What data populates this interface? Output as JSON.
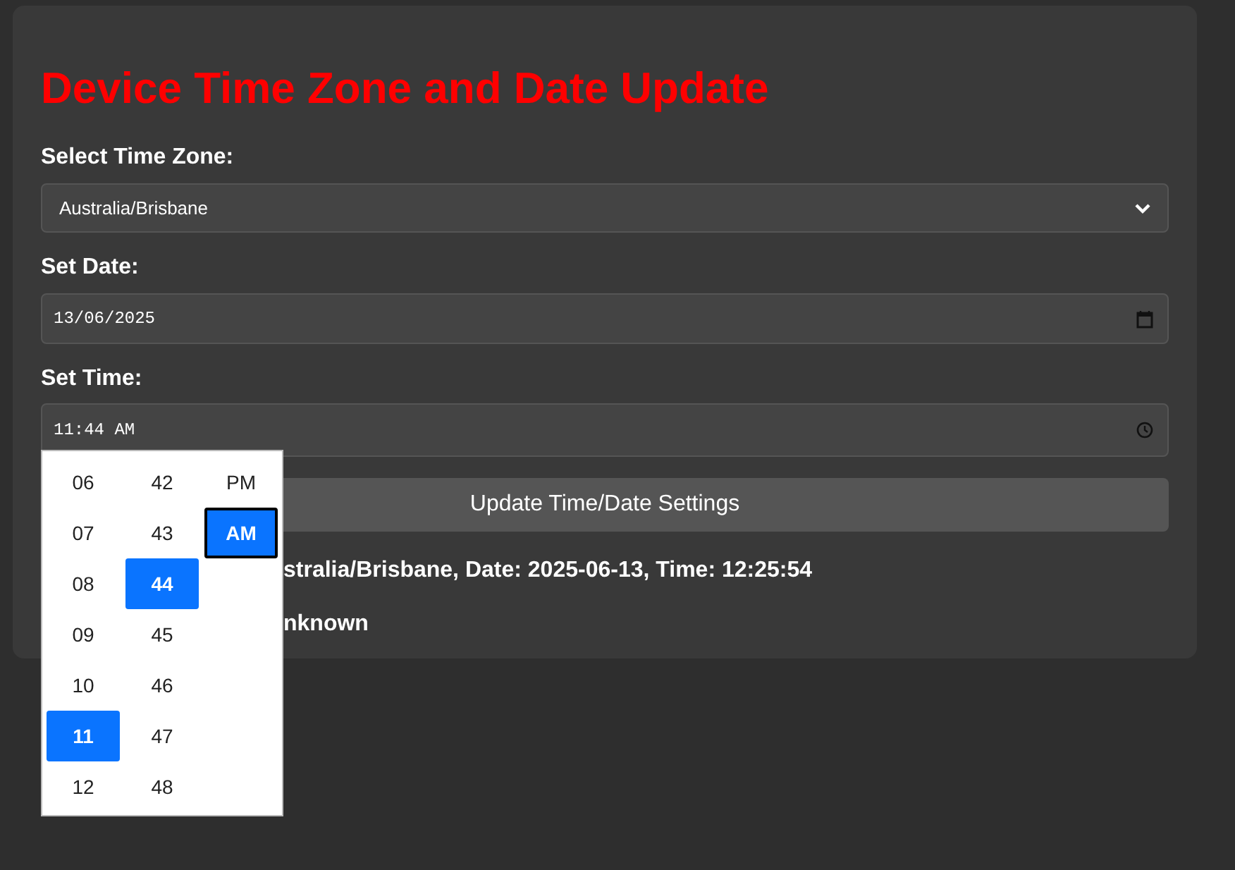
{
  "title": "Device Time Zone and Date Update",
  "timezone": {
    "label": "Select Time Zone:",
    "value": "Australia/Brisbane"
  },
  "date": {
    "label": "Set Date:",
    "value": "13/06/2025"
  },
  "time": {
    "label": "Set Time:",
    "value": "11:44 AM"
  },
  "update_button": "Update Time/Date Settings",
  "status_lines": [
    "stralia/Brisbane, Date: 2025-06-13, Time: 12:25:54",
    "nknown"
  ],
  "time_picker": {
    "columns": [
      [
        {
          "label": "06",
          "selected": false
        },
        {
          "label": "07",
          "selected": false
        },
        {
          "label": "08",
          "selected": false
        },
        {
          "label": "09",
          "selected": false
        },
        {
          "label": "10",
          "selected": false
        },
        {
          "label": "11",
          "selected": true
        },
        {
          "label": "12",
          "selected": false
        }
      ],
      [
        {
          "label": "42",
          "selected": false
        },
        {
          "label": "43",
          "selected": false
        },
        {
          "label": "44",
          "selected": true
        },
        {
          "label": "45",
          "selected": false
        },
        {
          "label": "46",
          "selected": false
        },
        {
          "label": "47",
          "selected": false
        },
        {
          "label": "48",
          "selected": false
        }
      ],
      [
        {
          "label": "PM",
          "selected": false
        },
        {
          "label": "AM",
          "selected": true
        }
      ]
    ]
  }
}
